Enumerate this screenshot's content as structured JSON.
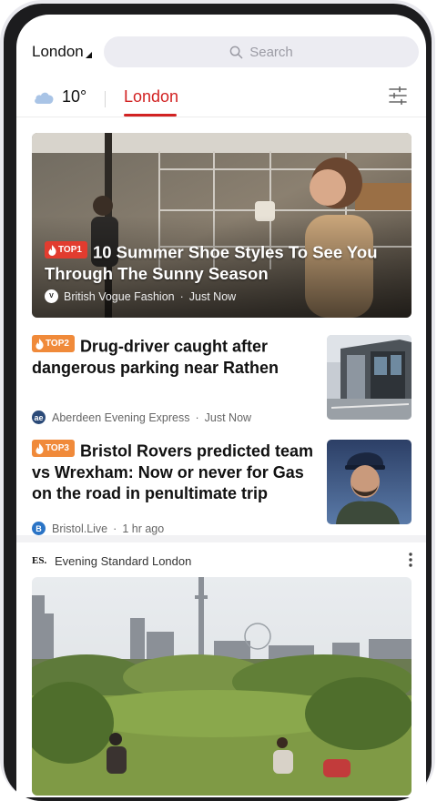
{
  "header": {
    "location": "London",
    "search_placeholder": "Search",
    "temperature": "10°",
    "active_tab": "London"
  },
  "hero": {
    "badge": "TOP1",
    "title": "10 Summer Shoe Styles To See You Through The Sunny Season",
    "source": "British Vogue Fashion",
    "time": "Just Now"
  },
  "articles": [
    {
      "badge": "TOP2",
      "title": "Drug-driver caught after dangerous parking near Rathen",
      "source": "Aberdeen Evening Express",
      "time": "Just Now"
    },
    {
      "badge": "TOP3",
      "title": "Bristol Rovers predicted team vs Wrexham: Now or never for Gas on the road in penultimate trip",
      "source": "Bristol.Live",
      "time": "1 hr ago"
    }
  ],
  "card": {
    "source": "Evening Standard London"
  },
  "colors": {
    "accent": "#d22222",
    "badge_top1": "#e23c2f",
    "badge_top": "#f08a3a"
  }
}
